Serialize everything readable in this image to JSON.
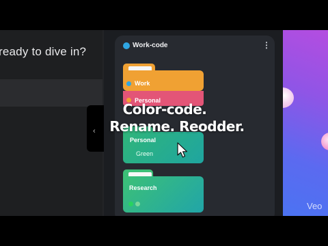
{
  "left": {
    "prompt": "ready to dive in?",
    "back_arrow": "‹"
  },
  "panel": {
    "title": "Work-code",
    "title_dot_color": "#2fa6e3",
    "menu_glyph": "⋮"
  },
  "folders": [
    {
      "label": "Work",
      "dot_color": "#2fa6e3",
      "color": "#f0a133"
    },
    {
      "label": "Personal",
      "dot_color": "#f0a133",
      "color": "#e35577"
    },
    {
      "label": "Personal",
      "sublabel": "Green",
      "color": "#2fb07a"
    },
    {
      "label": "Research",
      "color": "#3cbf77"
    }
  ],
  "overlay": {
    "line1": "Color-code.",
    "line2": "Rename. Reodder."
  },
  "watermark": "Veo"
}
